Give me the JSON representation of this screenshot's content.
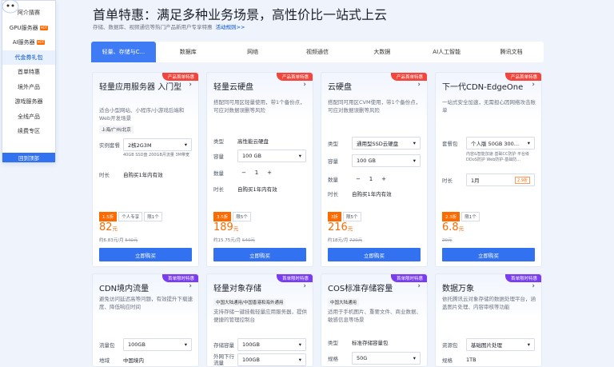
{
  "sidebar": {
    "items": [
      {
        "label": "阿介猜赛",
        "badge": ""
      },
      {
        "label": "GPU服务器",
        "badge": "HOT"
      },
      {
        "label": "AI服务器",
        "badge": "HOT"
      },
      {
        "label": "代金券礼包",
        "badge": ""
      },
      {
        "label": "首单特惠",
        "badge": ""
      },
      {
        "label": "境外产品",
        "badge": ""
      },
      {
        "label": "游戏服务器",
        "badge": ""
      },
      {
        "label": "全线产品",
        "badge": ""
      },
      {
        "label": "续费专区",
        "badge": ""
      }
    ],
    "active_index": 3,
    "footer_label": "回到顶部"
  },
  "header": {
    "title": "首单特惠：满足多种业务场景，高性价比一站式上云",
    "subtitle": "存储、数据库、视频通信等热门产品新用户专享特惠",
    "rules_link": "活动规则>>"
  },
  "tabs": [
    "轻量、存储与C...",
    "数据库",
    "网络",
    "视频通信",
    "大数据",
    "AI人工智能",
    "腾讯文档"
  ],
  "cards": {
    "lighthouse": {
      "title": "轻量应用服务器 入门型",
      "ribbon": "产品首单特惠",
      "desc": "适合小型网站、小程序/小游戏后端和Web开发场景",
      "region": "上海/广州/北京",
      "spec_label": "实例套餐",
      "spec_value": "2核2G3M",
      "spec_note": "40GB SSD盘 200GB月流量 3M带宽",
      "dur_label": "时长",
      "dur_value": "自购买1年内有效",
      "badges": [
        "1.5折",
        "个人专享",
        "限1个"
      ],
      "price": "82",
      "unit": "元",
      "orig_prefix": "约6.83元/月",
      "orig_price": "540元",
      "buy": "立即购买"
    },
    "cbs": {
      "title": "轻量云硬盘",
      "ribbon": "产品首单特惠",
      "desc": "搭配同可用区轻量使用，带1个备份点，可应对数据误删等风险",
      "type_label": "类型",
      "type_value": "高性能云硬盘",
      "cap_label": "容量",
      "cap_value": "100 GB",
      "qty_label": "数量",
      "qty_value": "1",
      "dur_label": "时长",
      "dur_value": "自购买1年内有效",
      "badges": [
        "3.5折",
        "限5个"
      ],
      "price": "189",
      "unit": "元",
      "orig_prefix": "约15.75元/月",
      "orig_price": "540元",
      "buy": "立即购买"
    },
    "disk": {
      "title": "云硬盘",
      "ribbon": "产品首单特惠",
      "desc": "搭配同可用区CVM使用，带1个备份点，可应对数据误删等风险",
      "type_label": "类型",
      "type_value": "通用型SSD云硬盘",
      "cap_label": "容量",
      "cap_value": "100 GB",
      "qty_label": "数量",
      "qty_value": "1",
      "dur_label": "时长",
      "dur_value": "自购买1年内有效",
      "badges": [
        "3折",
        "限5个"
      ],
      "price": "216",
      "unit": "元",
      "orig_prefix": "约18元/月",
      "orig_price": "720元",
      "buy": "立即购买"
    },
    "edgeone": {
      "title": "下一代CDN-EdgeOne",
      "ribbon": "产品首单特惠",
      "desc": "一站式安全加速，无需担心因网络攻击账单",
      "plan_label": "套餐包",
      "plan_value": "个人版 50GB 300...",
      "plan_note": "内容&智能加速 基础CC防护 平台级DDoS防护 Web防护-基础防...",
      "dur_label": "时长",
      "dur_value": "1月",
      "dur_hot": "2.9折",
      "badges": [
        "2.3折",
        "限1个"
      ],
      "price": "6.8",
      "unit": "元",
      "orig_price": "29元",
      "buy": "立即购买"
    },
    "cdn": {
      "title": "CDN境内流量",
      "ribbon": "首单限时特惠",
      "desc": "避免访问延迟高等问题，有效提升下载速度、降低响应时间",
      "pkg_label": "流量包",
      "pkg_value": "100GB",
      "area_label": "地域",
      "area_value": "中国境内"
    },
    "lightcos": {
      "title": "轻量对象存储",
      "ribbon": "首单限时特惠",
      "region": "中国大陆通用/中国香港和海外通用",
      "desc": "支持存储一键挂载轻量应用服务器，提供便捷的管理控制台",
      "cap_label": "存储容量",
      "cap_value": "100GB",
      "traffic_label": "外网下行流量",
      "traffic_value": "100GB"
    },
    "cos": {
      "title": "COS标准存储容量",
      "ribbon": "首单限时特惠",
      "region": "中国大陆通用",
      "desc": "适用于手机图片、重要文件、商业数据、敏感信息等场景",
      "type_label": "类型",
      "type_value": "标准存储容量包",
      "spec_label": "规格",
      "spec_value": "50G"
    },
    "ci": {
      "title": "数据万象",
      "ribbon": "首单限时特惠",
      "desc": "依托腾讯云对象存储的数据处理平台，涵盖图片处理、内容审核等功能",
      "res_label": "资源包",
      "res_value": "基础图片处理",
      "spec_label": "规格",
      "spec_value": "1TB"
    }
  },
  "colors": {
    "accent": "#3271f0",
    "price": "#ff6a00",
    "ribbon_red": "#f2463c",
    "ribbon_purple": "#7a3cf0"
  }
}
